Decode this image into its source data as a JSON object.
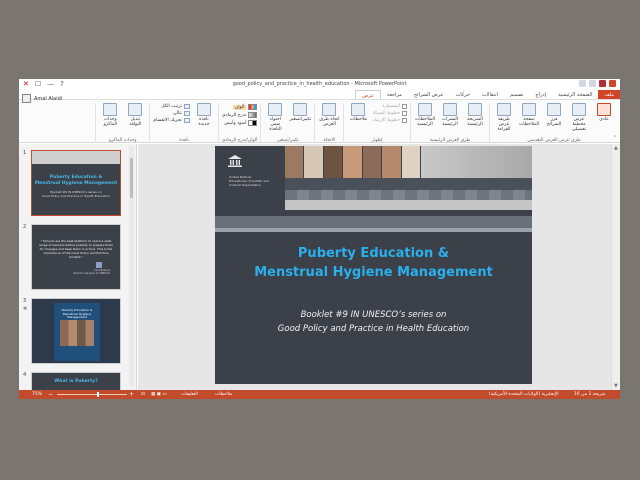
{
  "window": {
    "title": "good_policy_and_practice_in_health_education - Microsoft PowerPoint",
    "controls": [
      "✕",
      "☐",
      "—",
      "?"
    ]
  },
  "user": {
    "name": "Amal Alaidi"
  },
  "tabs": [
    {
      "label": "ملف",
      "kind": "file"
    },
    {
      "label": "الصفحة الرئيسية"
    },
    {
      "label": "إدراج"
    },
    {
      "label": "تصميم"
    },
    {
      "label": "انتقالات"
    },
    {
      "label": "حركات"
    },
    {
      "label": "عرض الشرائح"
    },
    {
      "label": "مراجعة"
    },
    {
      "label": "عرض",
      "active": true
    }
  ],
  "ribbon": {
    "groups": [
      {
        "label": "طرق عرض العرض التقديمي",
        "buttons": [
          {
            "label": "عادي",
            "icon": "normal-view-icon",
            "selected": true
          },
          {
            "label": "عرض مخطط تفصيلي",
            "icon": "outline-view-icon"
          },
          {
            "label": "فرز الشرائح",
            "icon": "slide-sorter-icon"
          },
          {
            "label": "صفحة الملاحظات",
            "icon": "notes-page-icon"
          },
          {
            "label": "طريقة عرض القراءة",
            "icon": "reading-view-icon"
          }
        ]
      },
      {
        "label": "طرق العرض الرئيسية",
        "buttons": [
          {
            "label": "الشريحة الرئيسية",
            "icon": "slide-master-icon"
          },
          {
            "label": "النشرات الرئيسية",
            "icon": "handout-master-icon"
          },
          {
            "label": "الملاحظات الرئيسية",
            "icon": "notes-master-icon"
          }
        ]
      },
      {
        "label": "إظهار",
        "checks": [
          "المسطرة",
          "خطوط الشبكة",
          "خطوط الإرشاد"
        ],
        "buttons": [
          {
            "label": "ملاحظات",
            "icon": "notes-icon"
          }
        ]
      },
      {
        "label": "الاتجاه",
        "buttons": [
          {
            "label": "اتجاه طرق العرض",
            "icon": "direction-icon"
          }
        ]
      },
      {
        "label": "تكبير/تصغير",
        "buttons": [
          {
            "label": "تكبير/تصغير",
            "icon": "zoom-icon"
          },
          {
            "label": "احتواء ضمن النافذة",
            "icon": "fit-to-window-icon"
          }
        ]
      },
      {
        "label": "ألوان/تدرج الرمادي",
        "items": [
          "ألوان",
          "تدرج الرمادي",
          "أسود وأبيض"
        ]
      },
      {
        "label": "نافذة",
        "buttons": [
          {
            "label": "نافذة جديدة",
            "icon": "new-window-icon"
          }
        ],
        "items": [
          "ترتيب الكل",
          "تتالي",
          "تحريك الانقسام"
        ]
      },
      {
        "label": "وحدات الماكرو",
        "buttons": [
          {
            "label": "تبديل النوافذ",
            "icon": "switch-windows-icon"
          },
          {
            "label": "وحدات الماكرو",
            "icon": "macros-icon"
          }
        ]
      }
    ]
  },
  "thumbnails": [
    {
      "number": "1",
      "title_line1": "Puberty Education &",
      "title_line2": "Menstrual Hygiene Management",
      "sub_line1": "Booklet #9 IN UNESCO's series on",
      "sub_line2": "Good Policy and Practice in Health Education"
    },
    {
      "number": "2",
      "quote": "\" Schools are the best platform to reach a wide range of learners before puberty to prepare them for changes and keep them in school. This is the importance of the Good Policy and Practice booklet.\"",
      "name": "Irina Bokova",
      "role": "Director-General of UNESCO"
    },
    {
      "number": "3",
      "card_title": "Puberty Education & Menstrual Hygiene Management"
    },
    {
      "number": "4",
      "title": "What is Puberty?"
    }
  ],
  "slide": {
    "logo_text": [
      "United Nations",
      "Educational, Scientific and",
      "Cultural Organization"
    ],
    "title_line1": "Puberty Education &",
    "title_line2": "Menstrual Hygiene Management",
    "sub_line1": "Booklet #9 IN UNESCO’s series on",
    "sub_line2": "Good Policy and Practice in Health Education"
  },
  "statusbar": {
    "slide_info": "شريحة 1 من 16",
    "language": "الإنجليزية (الولايات المتحدة الأمريكية)",
    "notes": "ملاحظات",
    "comments": "التعليقات",
    "zoom": "75%"
  },
  "colors": {
    "accent": "#c24b2b",
    "slide_bg": "#3b4049",
    "title_blue": "#2ab0ec"
  }
}
